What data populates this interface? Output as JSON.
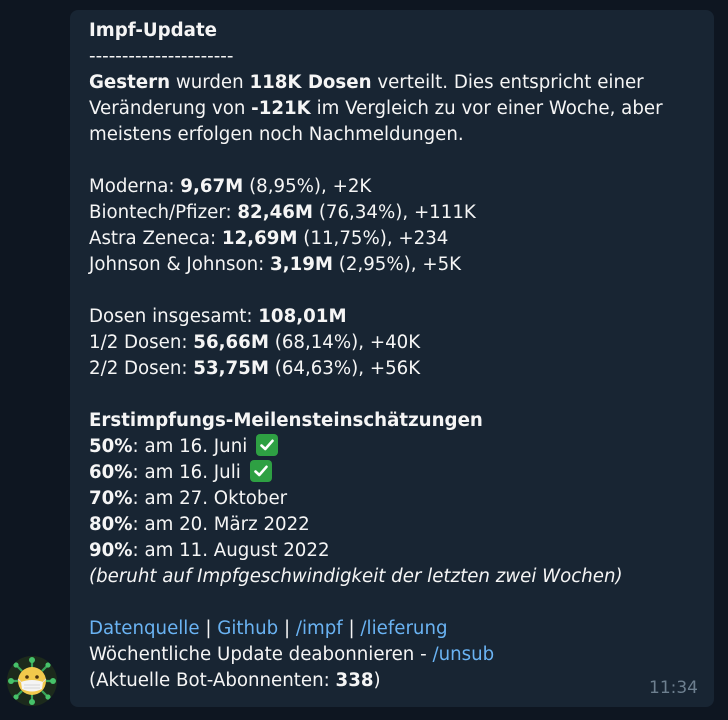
{
  "title": "Impf-Update",
  "divider": "----------------------",
  "intro": {
    "p1": "Gestern",
    "p2": " wurden ",
    "p3": "118K Dosen",
    "p4": " verteilt. Dies entspricht einer",
    "l2a": "Veränderung von ",
    "l2b": "-121K",
    "l2c": " im Vergleich zu vor einer Woche, aber",
    "l3": "meistens erfolgen noch Nachmeldungen."
  },
  "vaccines": [
    {
      "name": "Moderna: ",
      "total": "9,67M",
      "pct": " (8,95%)",
      "sep": ", ",
      "delta": "+2K"
    },
    {
      "name": "Biontech/Pfizer: ",
      "total": "82,46M",
      "pct": " (76,34%)",
      "sep": ", ",
      "delta": "+111K"
    },
    {
      "name": "Astra Zeneca: ",
      "total": "12,69M",
      "pct": " (11,75%)",
      "sep": ", ",
      "delta": "+234"
    },
    {
      "name": "Johnson & Johnson: ",
      "total": "3,19M",
      "pct": " (2,95%)",
      "sep": ", ",
      "delta": "+5K"
    }
  ],
  "doses": {
    "total_label": "Dosen insgesamt: ",
    "total_value": "108,01M",
    "half_label": "1/2 Dosen: ",
    "half_value": "56,66M",
    "half_pct": " (68,14%)",
    "half_sep": ", ",
    "half_delta": "+40K",
    "full_label": "2/2 Dosen: ",
    "full_value": "53,75M",
    "full_pct": " (64,63%)",
    "full_sep": ", ",
    "full_delta": "+56K"
  },
  "milestones": {
    "heading": "Erstimpfungs-Meilensteinschätzungen",
    "items": [
      {
        "pct": "50%",
        "text": ": am 16. Juni",
        "done": true
      },
      {
        "pct": "60%",
        "text": ": am 16. Juli",
        "done": true
      },
      {
        "pct": "70%",
        "text": ": am 27. Oktober",
        "done": false
      },
      {
        "pct": "80%",
        "text": ": am 20. März 2022",
        "done": false
      },
      {
        "pct": "90%",
        "text": ": am 11. August 2022",
        "done": false
      }
    ],
    "note": "(beruht auf Impfgeschwindigkeit der letzten zwei Wochen)"
  },
  "footer": {
    "links": [
      "Datenquelle",
      "Github",
      "/impf",
      "/lieferung"
    ],
    "pipe": " | ",
    "unsub_text": "Wöchentliche Update deabonnieren - ",
    "unsub_link": "/unsub",
    "subs_label": "(Aktuelle Bot-Abonnenten: ",
    "subs_value": "338",
    "subs_close": ")"
  },
  "timestamp": "11:34",
  "colors": {
    "background": "#0e1621",
    "bubble": "#182533",
    "link": "#6ab3f3",
    "text": "#f5f5f5",
    "check": "#2ea043",
    "timestamp": "#6d7f8f"
  },
  "icons": {
    "avatar": "virus-mask-face-avatar",
    "check": "check-mark-button"
  }
}
